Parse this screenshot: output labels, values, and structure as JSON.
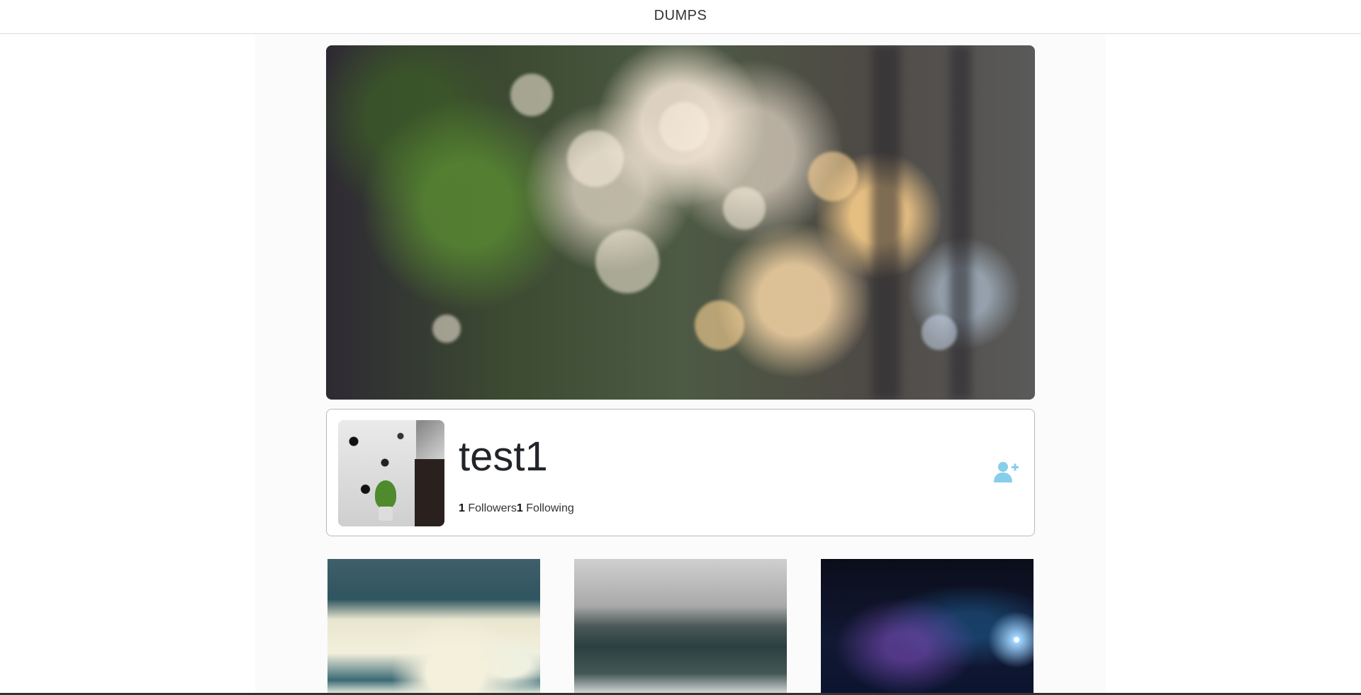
{
  "header": {
    "brand": "DUMPS"
  },
  "profile": {
    "username": "test1",
    "followers_count": "1",
    "followers_label": "Followers",
    "following_count": "1",
    "following_label": "Following",
    "follow_icon": "user-plus-icon"
  },
  "colors": {
    "accent": "#87ceeb",
    "card_border": "#b9b9b9"
  }
}
